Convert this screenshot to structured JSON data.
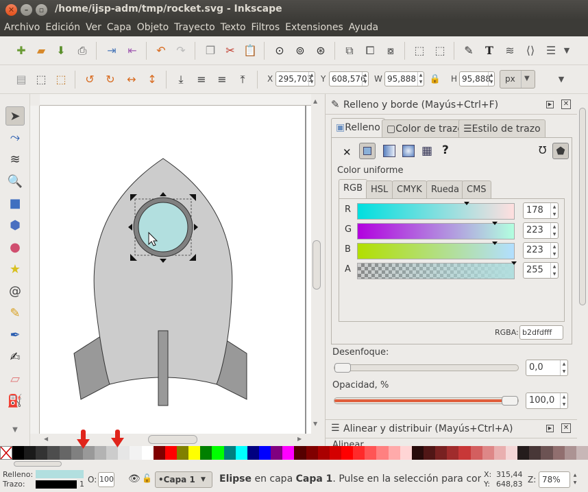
{
  "window": {
    "title": "/home/ijsp-adm/tmp/rocket.svg - Inkscape"
  },
  "menu": [
    "Archivo",
    "Edición",
    "Ver",
    "Capa",
    "Objeto",
    "Trayecto",
    "Texto",
    "Filtros",
    "Extensiones",
    "Ayuda"
  ],
  "coords": {
    "x_label": "X",
    "x_value": "295,703",
    "y_label": "Y",
    "y_value": "608,576",
    "w_label": "W",
    "w_value": "95,888",
    "h_label": "H",
    "h_value": "95,888",
    "unit": "px"
  },
  "fill_stroke": {
    "title": "Relleno y borde (Mayús+Ctrl+F)",
    "tabs": [
      "Relleno",
      "Color de trazo",
      "Estilo de trazo"
    ],
    "active_tab": "Relleno",
    "paint_type": "Color uniforme",
    "mode_tabs": [
      "RGB",
      "HSL",
      "CMYK",
      "Rueda",
      "CMS"
    ],
    "active_mode": "RGB",
    "channels": [
      {
        "label": "R",
        "value": "178",
        "level": 0.698
      },
      {
        "label": "G",
        "value": "223",
        "level": 0.875
      },
      {
        "label": "B",
        "value": "223",
        "level": 0.875
      },
      {
        "label": "A",
        "value": "255",
        "level": 1.0
      }
    ],
    "rgba_label": "RGBA:",
    "rgba_value": "b2dfdfff",
    "blur_label": "Desenfoque:",
    "blur_value": "0,0",
    "blur_level": 0.0,
    "opacity_label": "Opacidad, %",
    "opacity_value": "100,0",
    "opacity_level": 1.0
  },
  "align_panel": {
    "title": "Alinear y distribuir (Mayús+Ctrl+A)",
    "next_label": "Alinear"
  },
  "status": {
    "fill_label": "Relleno:",
    "stroke_label": "Trazo:",
    "stroke_width": "1",
    "opacity_label": "O:",
    "opacity_value": "100",
    "layer": "•Capa 1",
    "message_object": "Elipse",
    "message_middle": " en capa ",
    "message_layer": "Capa 1",
    "message_rest": ". Pulse en la selección para conmu",
    "x_label": "X:",
    "x_value": "315,44",
    "y_label": "Y:",
    "y_value": "648,83",
    "zoom_label": "Z:",
    "zoom_value": "78%"
  },
  "colors": {
    "fill": "#b2dfdf",
    "stroke": "#000000",
    "rocket_body": "#cccccc",
    "fin": "#999999",
    "window_ring": "#808080",
    "title_bg": "#3c3b37",
    "accent": "#e2501a"
  },
  "palette": [
    "#000000",
    "#1a1a1a",
    "#333333",
    "#4d4d4d",
    "#666666",
    "#808080",
    "#999999",
    "#b3b3b3",
    "#cccccc",
    "#e6e6e6",
    "#f2f2f2",
    "#ffffff",
    "#800000",
    "#ff0000",
    "#808000",
    "#ffff00",
    "#008000",
    "#00ff00",
    "#008080",
    "#00ffff",
    "#000080",
    "#0000ff",
    "#800080",
    "#ff00ff",
    "#550000",
    "#800000",
    "#aa0000",
    "#d40000",
    "#ff0000",
    "#ff2a2a",
    "#ff5555",
    "#ff8080",
    "#ffaaaa",
    "#ffd5d5",
    "#280b0b",
    "#501616",
    "#782121",
    "#a02c2c",
    "#c83737",
    "#d35f5f",
    "#de8787",
    "#e9afaf",
    "#f4d7d7",
    "#241c1c",
    "#483737",
    "#6c5353",
    "#916f6f",
    "#ac9393",
    "#c8b7b7"
  ]
}
